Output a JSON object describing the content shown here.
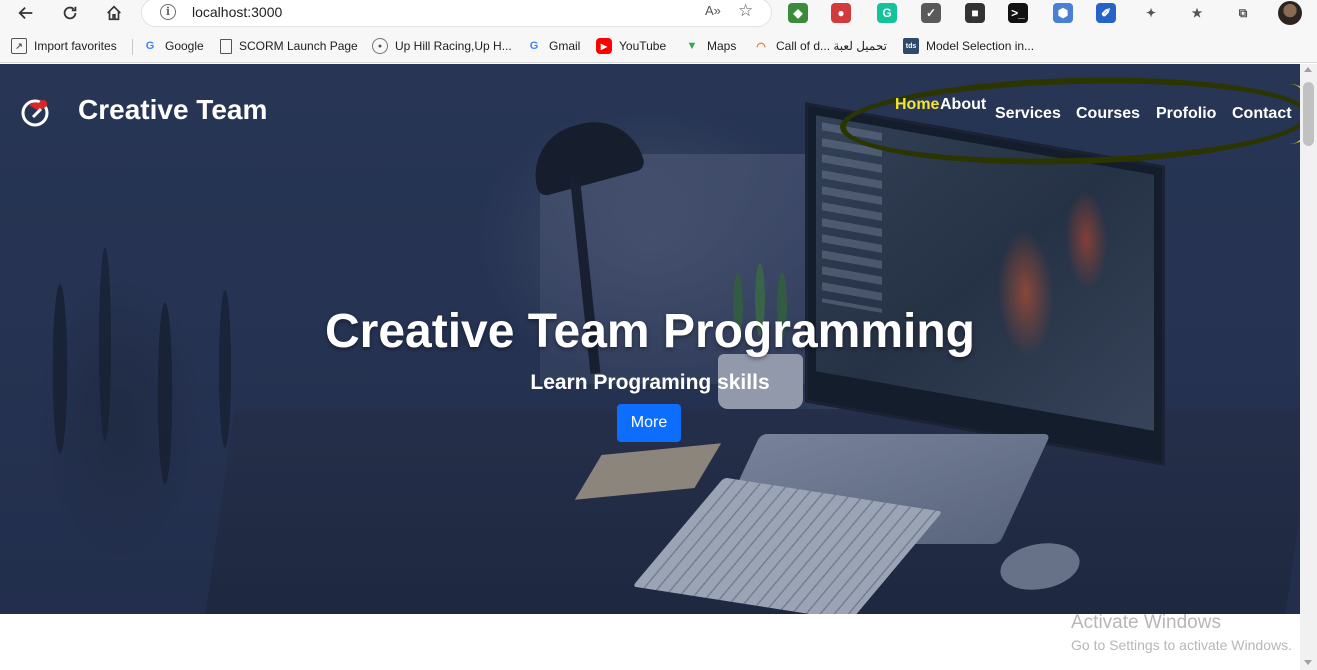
{
  "browser": {
    "url": "localhost:3000",
    "read_aloud_label": "A»",
    "extensions": [
      {
        "name": "earth-extension-icon",
        "color": "#3a8c3a",
        "glyph": "◆"
      },
      {
        "name": "pin-extension-icon",
        "color": "#d23b3b",
        "glyph": "●"
      },
      {
        "name": "grammarly-icon",
        "color": "#15c39a",
        "glyph": "G"
      },
      {
        "name": "shield-extension-icon",
        "color": "#5a5a5a",
        "glyph": "✓"
      },
      {
        "name": "lock-extension-icon",
        "color": "#333333",
        "glyph": "■"
      },
      {
        "name": "terminal-icon",
        "color": "#111111",
        "glyph": ">_"
      },
      {
        "name": "vpn-extension-icon",
        "color": "#4a7fd6",
        "glyph": "⬢"
      },
      {
        "name": "feather-extension-icon",
        "color": "#2563c9",
        "glyph": "✐"
      },
      {
        "name": "puzzle-extensions-icon",
        "color": "#555555",
        "glyph": "✦"
      },
      {
        "name": "favorites-icon",
        "color": "#555555",
        "glyph": "★"
      },
      {
        "name": "collections-icon",
        "color": "#555555",
        "glyph": "⧉"
      }
    ]
  },
  "bookmarks": [
    {
      "label": "Import favorites",
      "icon": "import-icon",
      "color": "#555555"
    },
    {
      "label": "Google",
      "icon": "google-icon",
      "color": "#4285f4"
    },
    {
      "label": "SCORM Launch Page",
      "icon": "page-icon",
      "color": "#555555"
    },
    {
      "label": "Up Hill Racing,Up H...",
      "icon": "racing-icon",
      "color": "#555555"
    },
    {
      "label": "Gmail",
      "icon": "google-icon",
      "color": "#4285f4"
    },
    {
      "label": "YouTube",
      "icon": "youtube-icon",
      "color": "#ff0000"
    },
    {
      "label": "Maps",
      "icon": "maps-icon",
      "color": "#34a853"
    },
    {
      "label": "Call of d... تحميل لعبة",
      "icon": "rainbow-icon",
      "color": "#e07a2a"
    },
    {
      "label": "Model Selection in...",
      "icon": "tds-icon",
      "color": "#2d4a6b"
    }
  ],
  "site": {
    "brand": "Creative Team",
    "nav": [
      "Home",
      "About",
      "Services",
      "Courses",
      "Profolio",
      "Contact"
    ],
    "hero_title": "Creative Team Programming",
    "hero_subtitle": "Learn Programing skills",
    "cta_label": "More"
  },
  "watermark": {
    "title": "Activate Windows",
    "subtitle": "Go to Settings to activate Windows."
  },
  "colors": {
    "nav_active": "#f5e628",
    "cta": "#0d6efd",
    "annotation": "#2b3500"
  }
}
